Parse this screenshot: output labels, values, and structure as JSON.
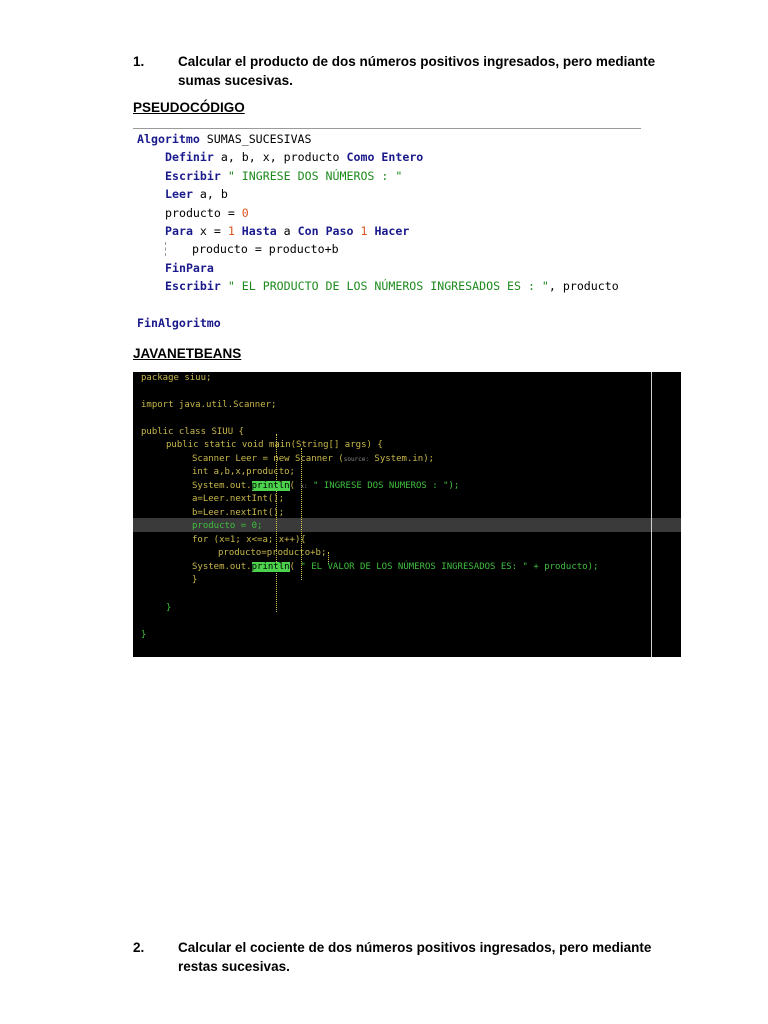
{
  "exercise1": {
    "number": "1.",
    "text": "Calcular el producto de dos números positivos ingresados, pero mediante sumas sucesivas."
  },
  "pseudocode": {
    "heading": "PSEUDOCÓDIGO",
    "lines": {
      "l1": {
        "kw": "Algoritmo",
        "name": " SUMAS_SUCESIVAS"
      },
      "l2": {
        "kw1": "Definir",
        "mid": " a, b, x, producto ",
        "kw2": "Como Entero"
      },
      "l3": {
        "kw": "Escribir",
        "str": " \" INGRESE DOS NÚMEROS : \""
      },
      "l4": {
        "kw": "Leer",
        "rest": " a, b"
      },
      "l5": {
        "a": "producto = ",
        "n": "0"
      },
      "l6": {
        "kw1": "Para",
        "a": " x = ",
        "n1": "1",
        "kw2": " Hasta",
        "b": " a ",
        "kw3": "Con Paso",
        "c": " ",
        "n2": "1",
        "kw4": " Hacer"
      },
      "l7": {
        "text": "producto = producto+b"
      },
      "l8": {
        "kw": "FinPara"
      },
      "l9": {
        "kw": "Escribir",
        "str": " \" EL PRODUCTO DE LOS NÚMEROS INGRESADOS ES : \"",
        "rest": ", producto"
      },
      "l10": {
        "kw": "FinAlgoritmo"
      }
    }
  },
  "java": {
    "heading": "JAVANETBEANS",
    "l1": "package siuu;",
    "l2": "import java.util.Scanner;",
    "l3": "public class SIUU {",
    "l4": "public static void main(String[] args) {",
    "l5": {
      "a": "Scanner Leer = new Scanner (",
      "hint": "source:",
      "b": " System.in);"
    },
    "l6": "int a,b,x,producto;",
    "l7": {
      "a": "System.out.",
      "m": "println",
      "b": "( ",
      "hint": "x:",
      "s": " \" INGRESE DOS NUMEROS : \");"
    },
    "l8": "a=Leer.nextInt();",
    "l9": "b=Leer.nextInt();",
    "l10": "producto = 0;",
    "l11": "for (x=1; x<=a; x++){",
    "l12": "producto=producto+b;",
    "l13": {
      "a": "System.out.",
      "m": "println",
      "b": "( ",
      "s": "\" EL VALOR DE LOS NÚMEROS INGRESADOS ES: \" + producto);"
    },
    "l14": "}",
    "l15": "}",
    "l16": "}"
  },
  "exercise2": {
    "number": "2.",
    "text": "Calcular el cociente de dos números positivos ingresados, pero mediante restas sucesivas."
  }
}
